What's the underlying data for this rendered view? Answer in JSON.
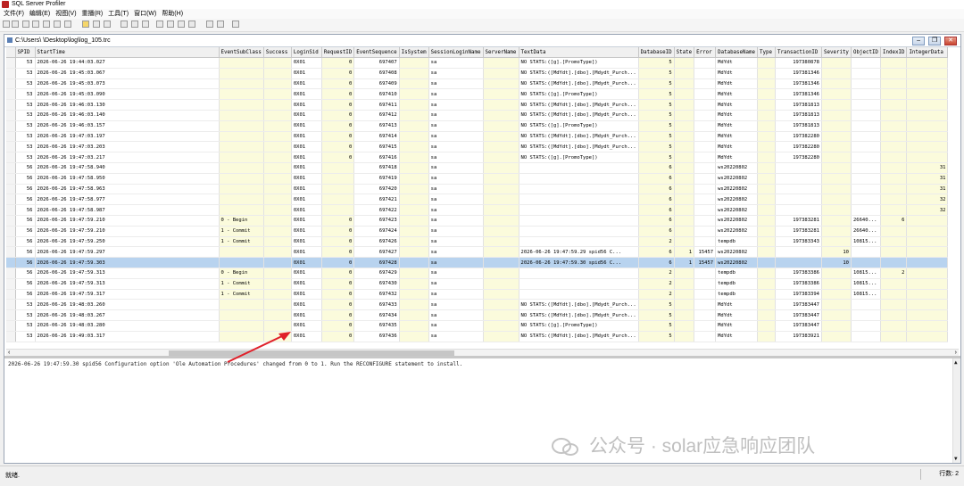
{
  "app": {
    "title": "SQL Server Profiler"
  },
  "menu": [
    "文件(F)",
    "编辑(E)",
    "视图(V)",
    "重播(R)",
    "工具(T)",
    "窗口(W)",
    "帮助(H)"
  ],
  "document": {
    "path": "C:\\Users\\          \\Desktop\\log\\log_105.trc"
  },
  "columns": [
    "",
    "SPID",
    "StartTime",
    "EventSubClass",
    "Success",
    "LoginSid",
    "RequestID",
    "EventSequence",
    "IsSystem",
    "SessionLoginName",
    "ServerName",
    "TextData",
    "DatabaseID",
    "State",
    "Error",
    "DatabaseName",
    "Type",
    "TransactionID",
    "Severity",
    "ObjectID",
    "IndexID",
    "IntegerData"
  ],
  "rows": [
    {
      "spid": "53",
      "start": "2026-06-26 19:44:03.027",
      "sub": "",
      "success": "",
      "sid": "0X01",
      "req": "0",
      "seq": "697407",
      "sys": "",
      "login": "sa",
      "server": "",
      "text": "NO STATS:([g].[PromoType])",
      "dbid": "5",
      "state": "",
      "error": "",
      "dbname": "MdYdt",
      "type": "",
      "txn": "197380878",
      "sev": "",
      "obj": "",
      "idx": "",
      "int": ""
    },
    {
      "spid": "53",
      "start": "2026-06-26 19:45:03.067",
      "sub": "",
      "success": "",
      "sid": "0X01",
      "req": "0",
      "seq": "697408",
      "sys": "",
      "login": "sa",
      "server": "",
      "text": "NO STATS:([MdYdt].[dbo].[Mdydt_Purch...",
      "dbid": "5",
      "state": "",
      "error": "",
      "dbname": "MdYdt",
      "type": "",
      "txn": "197381346",
      "sev": "",
      "obj": "",
      "idx": "",
      "int": ""
    },
    {
      "spid": "53",
      "start": "2026-06-26 19:45:03.073",
      "sub": "",
      "success": "",
      "sid": "0X01",
      "req": "0",
      "seq": "697409",
      "sys": "",
      "login": "sa",
      "server": "",
      "text": "NO STATS:([MdYdt].[dbo].[Mdydt_Purch...",
      "dbid": "5",
      "state": "",
      "error": "",
      "dbname": "MdYdt",
      "type": "",
      "txn": "197381346",
      "sev": "",
      "obj": "",
      "idx": "",
      "int": ""
    },
    {
      "spid": "53",
      "start": "2026-06-26 19:45:03.090",
      "sub": "",
      "success": "",
      "sid": "0X01",
      "req": "0",
      "seq": "697410",
      "sys": "",
      "login": "sa",
      "server": "",
      "text": "NO STATS:([g].[PromoType])",
      "dbid": "5",
      "state": "",
      "error": "",
      "dbname": "MdYdt",
      "type": "",
      "txn": "197381346",
      "sev": "",
      "obj": "",
      "idx": "",
      "int": ""
    },
    {
      "spid": "53",
      "start": "2026-06-26 19:46:03.130",
      "sub": "",
      "success": "",
      "sid": "0X01",
      "req": "0",
      "seq": "697411",
      "sys": "",
      "login": "sa",
      "server": "",
      "text": "NO STATS:([MdYdt].[dbo].[Mdydt_Purch...",
      "dbid": "5",
      "state": "",
      "error": "",
      "dbname": "MdYdt",
      "type": "",
      "txn": "197381813",
      "sev": "",
      "obj": "",
      "idx": "",
      "int": ""
    },
    {
      "spid": "53",
      "start": "2026-06-26 19:46:03.140",
      "sub": "",
      "success": "",
      "sid": "0X01",
      "req": "0",
      "seq": "697412",
      "sys": "",
      "login": "sa",
      "server": "",
      "text": "NO STATS:([MdYdt].[dbo].[Mdydt_Purch...",
      "dbid": "5",
      "state": "",
      "error": "",
      "dbname": "MdYdt",
      "type": "",
      "txn": "197381813",
      "sev": "",
      "obj": "",
      "idx": "",
      "int": ""
    },
    {
      "spid": "53",
      "start": "2026-06-26 19:46:03.157",
      "sub": "",
      "success": "",
      "sid": "0X01",
      "req": "0",
      "seq": "697413",
      "sys": "",
      "login": "sa",
      "server": "",
      "text": "NO STATS:([g].[PromoType])",
      "dbid": "5",
      "state": "",
      "error": "",
      "dbname": "MdYdt",
      "type": "",
      "txn": "197381813",
      "sev": "",
      "obj": "",
      "idx": "",
      "int": ""
    },
    {
      "spid": "53",
      "start": "2026-06-26 19:47:03.197",
      "sub": "",
      "success": "",
      "sid": "0X01",
      "req": "0",
      "seq": "697414",
      "sys": "",
      "login": "sa",
      "server": "",
      "text": "NO STATS:([MdYdt].[dbo].[Mdydt_Purch...",
      "dbid": "5",
      "state": "",
      "error": "",
      "dbname": "MdYdt",
      "type": "",
      "txn": "197382280",
      "sev": "",
      "obj": "",
      "idx": "",
      "int": ""
    },
    {
      "spid": "53",
      "start": "2026-06-26 19:47:03.203",
      "sub": "",
      "success": "",
      "sid": "0X01",
      "req": "0",
      "seq": "697415",
      "sys": "",
      "login": "sa",
      "server": "",
      "text": "NO STATS:([MdYdt].[dbo].[Mdydt_Purch...",
      "dbid": "5",
      "state": "",
      "error": "",
      "dbname": "MdYdt",
      "type": "",
      "txn": "197382280",
      "sev": "",
      "obj": "",
      "idx": "",
      "int": ""
    },
    {
      "spid": "53",
      "start": "2026-06-26 19:47:03.217",
      "sub": "",
      "success": "",
      "sid": "0X01",
      "req": "0",
      "seq": "697416",
      "sys": "",
      "login": "sa",
      "server": "",
      "text": "NO STATS:([g].[PromoType])",
      "dbid": "5",
      "state": "",
      "error": "",
      "dbname": "MdYdt",
      "type": "",
      "txn": "197382280",
      "sev": "",
      "obj": "",
      "idx": "",
      "int": ""
    },
    {
      "spid": "56",
      "start": "2026-06-26 19:47:58.940",
      "sub": "",
      "success": "",
      "sid": "0X01",
      "req": "",
      "seq": "697418",
      "sys": "",
      "login": "sa",
      "server": "",
      "text": "",
      "dbid": "6",
      "state": "",
      "error": "",
      "dbname": "ws20220802",
      "type": "",
      "txn": "",
      "sev": "",
      "obj": "",
      "idx": "",
      "int": "31"
    },
    {
      "spid": "56",
      "start": "2026-06-26 19:47:58.950",
      "sub": "",
      "success": "",
      "sid": "0X01",
      "req": "",
      "seq": "697419",
      "sys": "",
      "login": "sa",
      "server": "",
      "text": "",
      "dbid": "6",
      "state": "",
      "error": "",
      "dbname": "ws20220802",
      "type": "",
      "txn": "",
      "sev": "",
      "obj": "",
      "idx": "",
      "int": "31"
    },
    {
      "spid": "56",
      "start": "2026-06-26 19:47:58.963",
      "sub": "",
      "success": "",
      "sid": "0X01",
      "req": "",
      "seq": "697420",
      "sys": "",
      "login": "sa",
      "server": "",
      "text": "",
      "dbid": "6",
      "state": "",
      "error": "",
      "dbname": "ws20220802",
      "type": "",
      "txn": "",
      "sev": "",
      "obj": "",
      "idx": "",
      "int": "31"
    },
    {
      "spid": "56",
      "start": "2026-06-26 19:47:58.977",
      "sub": "",
      "success": "",
      "sid": "0X01",
      "req": "",
      "seq": "697421",
      "sys": "",
      "login": "sa",
      "server": "",
      "text": "",
      "dbid": "6",
      "state": "",
      "error": "",
      "dbname": "ws20220802",
      "type": "",
      "txn": "",
      "sev": "",
      "obj": "",
      "idx": "",
      "int": "32"
    },
    {
      "spid": "56",
      "start": "2026-06-26 19:47:58.987",
      "sub": "",
      "success": "",
      "sid": "0X01",
      "req": "",
      "seq": "697422",
      "sys": "",
      "login": "sa",
      "server": "",
      "text": "",
      "dbid": "6",
      "state": "",
      "error": "",
      "dbname": "ws20220802",
      "type": "",
      "txn": "",
      "sev": "",
      "obj": "",
      "idx": "",
      "int": "32"
    },
    {
      "spid": "56",
      "start": "2026-06-26 19:47:59.210",
      "sub": "0 - Begin",
      "success": "",
      "sid": "0X01",
      "req": "0",
      "seq": "697423",
      "sys": "",
      "login": "sa",
      "server": "",
      "text": "",
      "dbid": "6",
      "state": "",
      "error": "",
      "dbname": "ws20220802",
      "type": "",
      "txn": "197383281",
      "sev": "",
      "obj": "26640...",
      "idx": "6",
      "int": ""
    },
    {
      "spid": "56",
      "start": "2026-06-26 19:47:59.210",
      "sub": "1 - Commit",
      "success": "",
      "sid": "0X01",
      "req": "0",
      "seq": "697424",
      "sys": "",
      "login": "sa",
      "server": "",
      "text": "",
      "dbid": "6",
      "state": "",
      "error": "",
      "dbname": "ws20220802",
      "type": "",
      "txn": "197383281",
      "sev": "",
      "obj": "26640...",
      "idx": "",
      "int": ""
    },
    {
      "spid": "56",
      "start": "2026-06-26 19:47:59.250",
      "sub": "1 - Commit",
      "success": "",
      "sid": "0X01",
      "req": "0",
      "seq": "697426",
      "sys": "",
      "login": "sa",
      "server": "",
      "text": "",
      "dbid": "2",
      "state": "",
      "error": "",
      "dbname": "tempdb",
      "type": "",
      "txn": "197383343",
      "sev": "",
      "obj": "10815...",
      "idx": "",
      "int": ""
    },
    {
      "spid": "56",
      "start": "2026-06-26 19:47:59.297",
      "sub": "",
      "success": "",
      "sid": "0X01",
      "req": "0",
      "seq": "697427",
      "sys": "",
      "login": "sa",
      "server": "",
      "text": "2026-06-26 19:47:59.29 spid56     C...",
      "dbid": "6",
      "state": "1",
      "error": "15457",
      "dbname": "ws20220802",
      "type": "",
      "txn": "",
      "sev": "10",
      "obj": "",
      "idx": "",
      "int": ""
    },
    {
      "spid": "56",
      "start": "2026-06-26 19:47:59.303",
      "sub": "",
      "success": "",
      "sid": "0X01",
      "req": "0",
      "seq": "697428",
      "sys": "",
      "login": "sa",
      "server": "",
      "text": "2026-06-26 19:47:59.30 spid56     C...",
      "dbid": "6",
      "state": "1",
      "error": "15457",
      "dbname": "ws20220802",
      "type": "",
      "txn": "",
      "sev": "10",
      "obj": "",
      "idx": "",
      "int": "",
      "selected": true
    },
    {
      "spid": "56",
      "start": "2026-06-26 19:47:59.313",
      "sub": "0 - Begin",
      "success": "",
      "sid": "0X01",
      "req": "0",
      "seq": "697429",
      "sys": "",
      "login": "sa",
      "server": "",
      "text": "",
      "dbid": "2",
      "state": "",
      "error": "",
      "dbname": "tempdb",
      "type": "",
      "txn": "197383386",
      "sev": "",
      "obj": "10815...",
      "idx": "2",
      "int": ""
    },
    {
      "spid": "56",
      "start": "2026-06-26 19:47:59.313",
      "sub": "1 - Commit",
      "success": "",
      "sid": "0X01",
      "req": "0",
      "seq": "697430",
      "sys": "",
      "login": "sa",
      "server": "",
      "text": "",
      "dbid": "2",
      "state": "",
      "error": "",
      "dbname": "tempdb",
      "type": "",
      "txn": "197383386",
      "sev": "",
      "obj": "10815...",
      "idx": "",
      "int": ""
    },
    {
      "spid": "56",
      "start": "2026-06-26 19:47:59.317",
      "sub": "1 - Commit",
      "success": "",
      "sid": "0X01",
      "req": "0",
      "seq": "697432",
      "sys": "",
      "login": "sa",
      "server": "",
      "text": "",
      "dbid": "2",
      "state": "",
      "error": "",
      "dbname": "tempdb",
      "type": "",
      "txn": "197383394",
      "sev": "",
      "obj": "10815...",
      "idx": "",
      "int": ""
    },
    {
      "spid": "53",
      "start": "2026-06-26 19:48:03.260",
      "sub": "",
      "success": "",
      "sid": "0X01",
      "req": "0",
      "seq": "697433",
      "sys": "",
      "login": "sa",
      "server": "",
      "text": "NO STATS:([MdYdt].[dbo].[Mdydt_Purch...",
      "dbid": "5",
      "state": "",
      "error": "",
      "dbname": "MdYdt",
      "type": "",
      "txn": "197383447",
      "sev": "",
      "obj": "",
      "idx": "",
      "int": ""
    },
    {
      "spid": "53",
      "start": "2026-06-26 19:48:03.267",
      "sub": "",
      "success": "",
      "sid": "0X01",
      "req": "0",
      "seq": "697434",
      "sys": "",
      "login": "sa",
      "server": "",
      "text": "NO STATS:([MdYdt].[dbo].[Mdydt_Purch...",
      "dbid": "5",
      "state": "",
      "error": "",
      "dbname": "MdYdt",
      "type": "",
      "txn": "197383447",
      "sev": "",
      "obj": "",
      "idx": "",
      "int": ""
    },
    {
      "spid": "53",
      "start": "2026-06-26 19:48:03.280",
      "sub": "",
      "success": "",
      "sid": "0X01",
      "req": "0",
      "seq": "697435",
      "sys": "",
      "login": "sa",
      "server": "",
      "text": "NO STATS:([g].[PromoType])",
      "dbid": "5",
      "state": "",
      "error": "",
      "dbname": "MdYdt",
      "type": "",
      "txn": "197383447",
      "sev": "",
      "obj": "",
      "idx": "",
      "int": ""
    },
    {
      "spid": "53",
      "start": "2026-06-26 19:49:03.317",
      "sub": "",
      "success": "",
      "sid": "0X01",
      "req": "0",
      "seq": "697436",
      "sys": "",
      "login": "sa",
      "server": "",
      "text": "NO STATS:([MdYdt].[dbo].[Mdydt_Purch...",
      "dbid": "5",
      "state": "",
      "error": "",
      "dbname": "MdYdt",
      "type": "",
      "txn": "197383921",
      "sev": "",
      "obj": "",
      "idx": "",
      "int": ""
    }
  ],
  "detail": {
    "text": "2026-06-26 19:47:59.30 spid56     Configuration option 'Ole Automation Procedures' changed from 0 to 1. Run the RECONFIGURE statement to install."
  },
  "watermark": {
    "text": "公众号 · solar应急响应团队"
  },
  "status": {
    "left": "就绪.",
    "right": "行数: 2"
  },
  "colors": {
    "selected_row": "#b8d3ef",
    "highlight_cell": "#fbfbdc",
    "arrow": "#e0202a"
  }
}
